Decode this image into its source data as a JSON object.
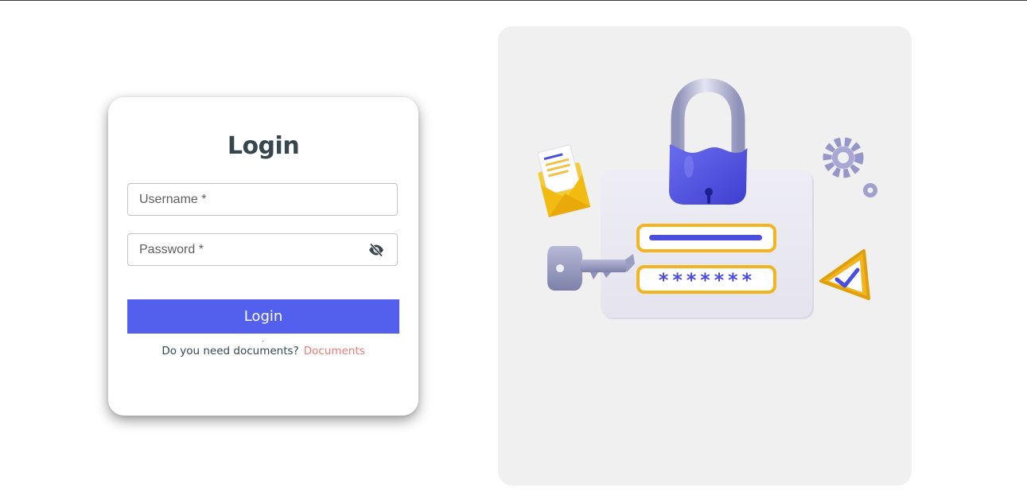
{
  "login": {
    "title": "Login",
    "username_placeholder": "Username *",
    "password_placeholder": "Password *",
    "password_visibility_icon": "eye-off-icon",
    "submit_label": "Login",
    "documents_prompt": "Do you need documents?",
    "documents_link": "Documents"
  },
  "illustration": {
    "password_mask": "*******",
    "icons": [
      "padlock-icon",
      "envelope-icon",
      "key-icon",
      "gear-icon",
      "check-warning-icon"
    ]
  },
  "colors": {
    "primary_button": "#5360ee",
    "title_text": "#37474f",
    "link": "#ef7a72",
    "panel_background": "#f0f0f0",
    "lock_blue": "#4b4de0",
    "field_gold": "#f2b51f"
  }
}
